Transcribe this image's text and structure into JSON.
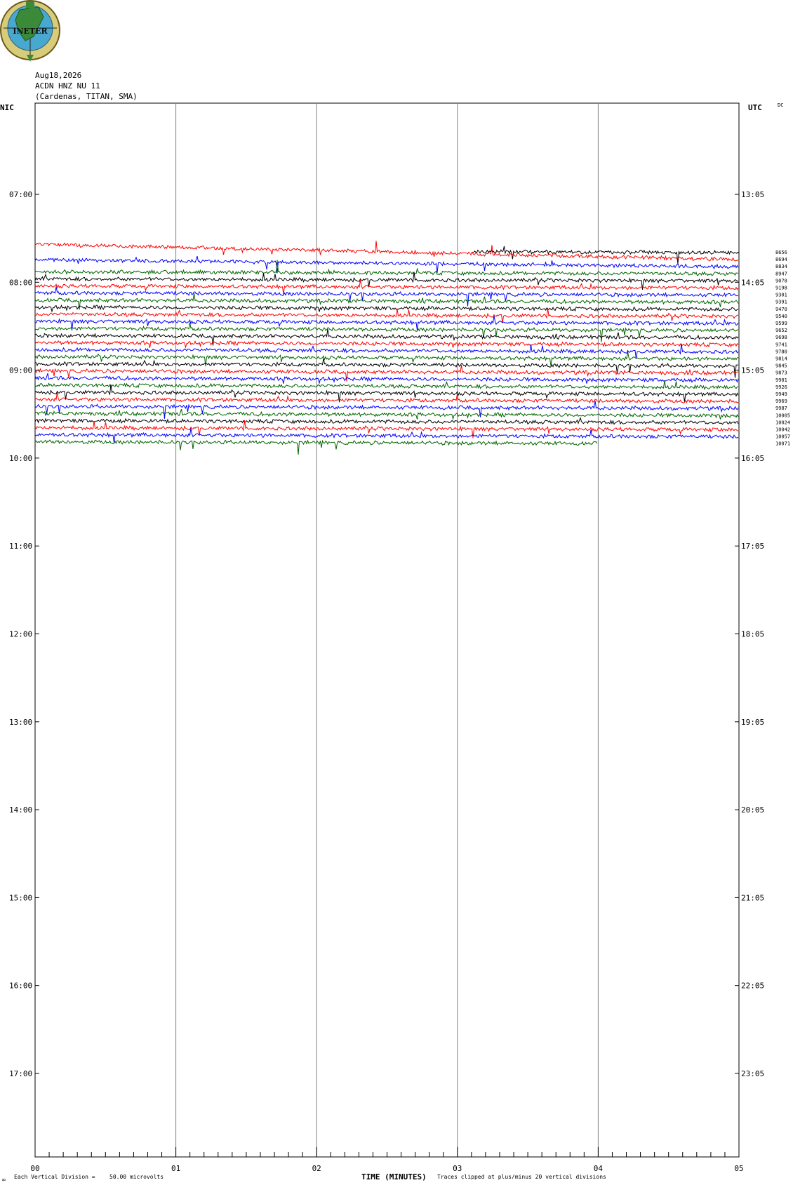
{
  "logo": {
    "text": "INETER"
  },
  "header": {
    "date": "Aug18,2026",
    "channel": "ACDN HNZ NU 11",
    "location": "(Cardenas, TITAN, SMA)"
  },
  "axis_labels": {
    "left_tz": "NIC",
    "right_tz": "UTC",
    "right_extra": "DC",
    "xlabel": "TIME (MINUTES)"
  },
  "footer": {
    "scale_note_prefix": "Each Vertical Division =",
    "scale_note_value": "50.00 microvolts",
    "clip_note": "Traces clipped at plus/minus 20 vertical divisions",
    "corner_mark": "∞"
  },
  "colors": {
    "red": "#ff0000",
    "blue": "#0000ff",
    "green": "#006400",
    "black": "#000000",
    "grid": "#808080"
  },
  "chart_data": {
    "type": "line",
    "title": "ACDN HNZ NU 11",
    "xlabel": "TIME (MINUTES)",
    "x_ticks": [
      "00",
      "01",
      "02",
      "03",
      "04",
      "05"
    ],
    "xlim": [
      0,
      5
    ],
    "left_time_ticks": [
      "07:00",
      "08:00",
      "09:00",
      "10:00",
      "11:00",
      "12:00",
      "13:00",
      "14:00",
      "15:00",
      "16:00",
      "17:00"
    ],
    "right_time_ticks": [
      "13:05",
      "14:05",
      "15:05",
      "16:05",
      "17:05",
      "18:05",
      "19:05",
      "20:05",
      "21:05",
      "22:05",
      "23:05"
    ],
    "trace_minutes": 5,
    "color_cycle": [
      "black",
      "red",
      "blue",
      "green"
    ],
    "dc_offsets": [
      "8656",
      "8694",
      "8834",
      "8947",
      "9078",
      "9198",
      "9301",
      "9391",
      "9470",
      "9540",
      "9599",
      "9652",
      "9698",
      "9741",
      "9780",
      "9814",
      "9845",
      "9873",
      "9901",
      "9926",
      "9949",
      "9969",
      "9987",
      "10005",
      "10024",
      "10042",
      "10057",
      "10071"
    ],
    "first_trace_start_min": 3.1,
    "last_trace_end_min": 4.0,
    "scale_microvolts_per_division": 50.0,
    "clip_divisions": 20
  }
}
